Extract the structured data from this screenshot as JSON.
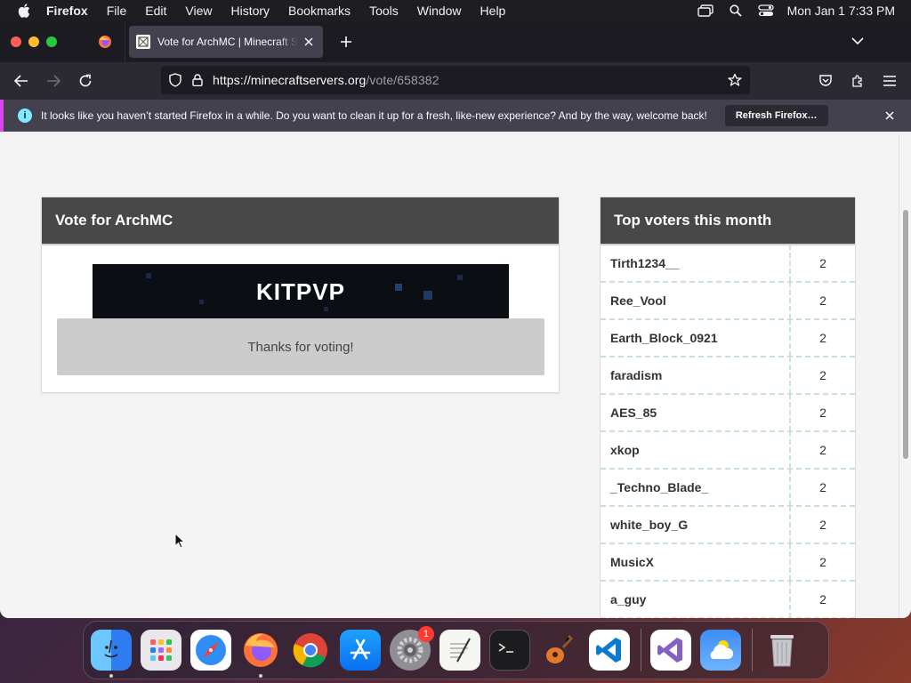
{
  "menubar": {
    "app_name": "Firefox",
    "items": [
      "File",
      "Edit",
      "View",
      "History",
      "Bookmarks",
      "Tools",
      "Window",
      "Help"
    ],
    "clock": "Mon Jan 1  7:33 PM"
  },
  "browser": {
    "tab_title": "Vote for ArchMC | Minecraft Ser",
    "url_host": "https://minecraftservers.org",
    "url_path": "/vote/658382",
    "notification": {
      "message": "It looks like you haven’t started Firefox in a while. Do you want to clean it up for a fresh, like-new experience? And by the way, welcome back!",
      "button": "Refresh Firefox…"
    }
  },
  "vote": {
    "title": "Vote for ArchMC",
    "banner_text": "KITPVP",
    "thanks": "Thanks for voting!"
  },
  "voters": {
    "title": "Top voters this month",
    "rows": [
      {
        "name": "Tirth1234__",
        "count": "2"
      },
      {
        "name": "Ree_Vool",
        "count": "2"
      },
      {
        "name": "Earth_Block_0921",
        "count": "2"
      },
      {
        "name": "faradism",
        "count": "2"
      },
      {
        "name": "AES_85",
        "count": "2"
      },
      {
        "name": "xkop",
        "count": "2"
      },
      {
        "name": "_Techno_Blade_",
        "count": "2"
      },
      {
        "name": "white_boy_G",
        "count": "2"
      },
      {
        "name": "MusicX",
        "count": "2"
      },
      {
        "name": "a_guy",
        "count": "2"
      }
    ]
  },
  "dock": {
    "apps": [
      "Finder",
      "Launchpad",
      "Safari",
      "Firefox",
      "Chrome",
      "App Store",
      "System Settings",
      "TextEdit",
      "Terminal",
      "GarageBand",
      "VS Code",
      "Visual Studio",
      "Weather",
      "Trash"
    ],
    "settings_badge": "1"
  },
  "colors": {
    "card_header": "#484848",
    "thanks_bg": "#cccccc",
    "accent_notification": "#d946ef"
  }
}
